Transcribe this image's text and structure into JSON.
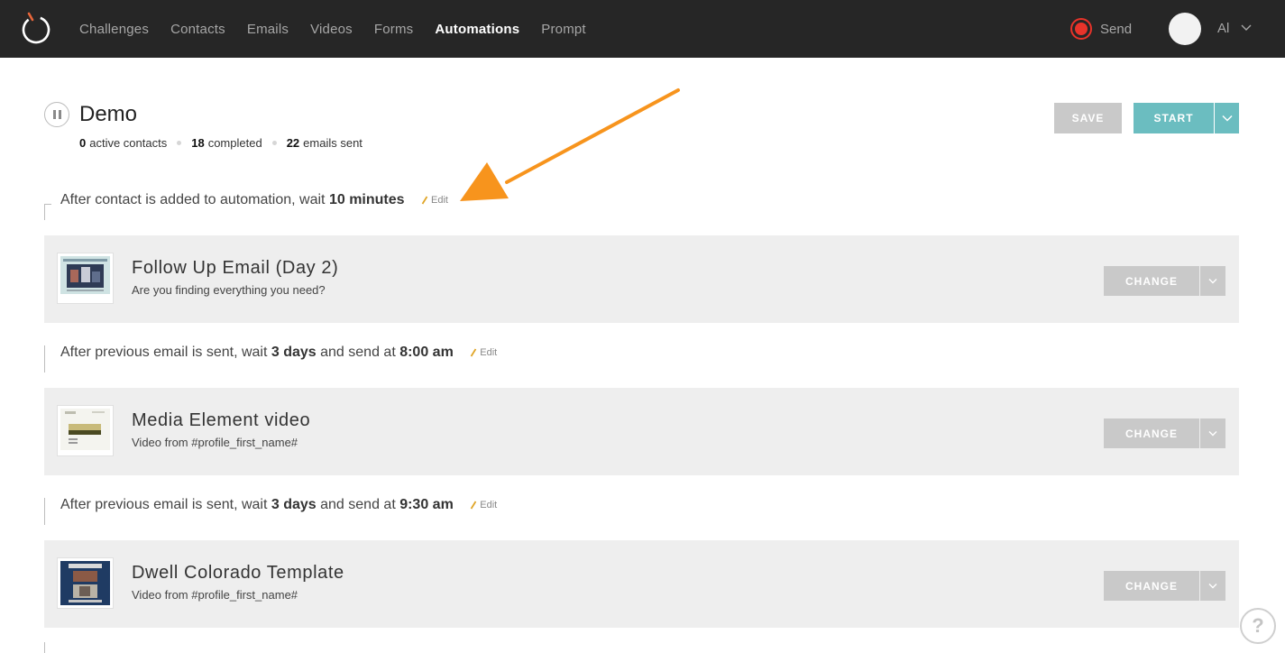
{
  "nav": {
    "items": [
      {
        "label": "Challenges",
        "active": false
      },
      {
        "label": "Contacts",
        "active": false
      },
      {
        "label": "Emails",
        "active": false
      },
      {
        "label": "Videos",
        "active": false
      },
      {
        "label": "Forms",
        "active": false
      },
      {
        "label": "Automations",
        "active": true
      },
      {
        "label": "Prompt",
        "active": false
      }
    ],
    "send_label": "Send",
    "user_name": "Al"
  },
  "automation": {
    "title": "Demo",
    "stats": {
      "active_count": "0",
      "active_label": "active contacts",
      "completed_count": "18",
      "completed_label": "completed",
      "emails_count": "22",
      "emails_label": "emails sent"
    },
    "save_label": "SAVE",
    "start_label": "START"
  },
  "waits": [
    {
      "prefix": "After contact is added to automation, wait ",
      "duration": "10 minutes",
      "middle": "",
      "time": "",
      "edit_label": "Edit"
    },
    {
      "prefix": "After previous email is sent, wait ",
      "duration": "3 days",
      "middle": " and send at ",
      "time": "8:00 am",
      "edit_label": "Edit"
    },
    {
      "prefix": "After previous email is sent, wait ",
      "duration": "3 days",
      "middle": " and send at ",
      "time": "9:30 am",
      "edit_label": "Edit"
    }
  ],
  "steps": [
    {
      "title": "Follow Up Email (Day 2)",
      "subtitle": "Are you finding everything you need?",
      "change_label": "CHANGE"
    },
    {
      "title": "Media Element video",
      "subtitle": "Video from #profile_first_name#",
      "change_label": "CHANGE"
    },
    {
      "title": "Dwell Colorado Template",
      "subtitle": "Video from #profile_first_name#",
      "change_label": "CHANGE"
    }
  ],
  "colors": {
    "topbar": "#262626",
    "accent_teal": "#6bbdc0",
    "record_red": "#e8332a",
    "annotation_orange": "#f7941d",
    "card_bg": "#eeeeee",
    "button_gray": "#c9c9c9"
  },
  "help": {
    "label": "?"
  }
}
